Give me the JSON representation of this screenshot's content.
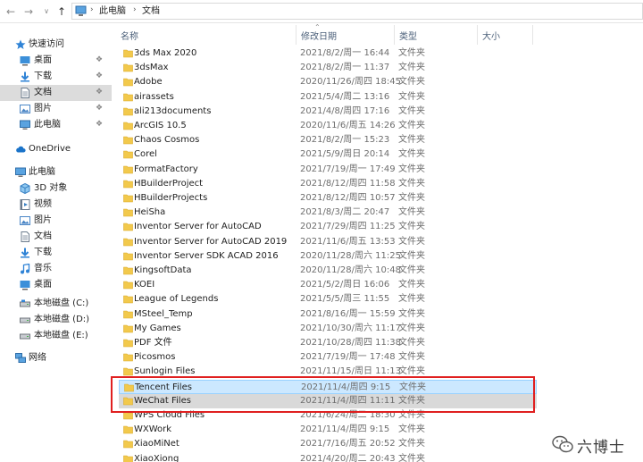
{
  "nav": {
    "back_icon": "arrow-left-icon",
    "forward_icon": "arrow-right-icon",
    "recent_icon": "chevron-down-icon",
    "up_icon": "arrow-up-icon"
  },
  "breadcrumb": [
    "此电脑",
    "文档"
  ],
  "columns": {
    "name": "名称",
    "date": "修改日期",
    "type": "类型",
    "size": "大小"
  },
  "sidebar": {
    "quick_access": "快速访问",
    "quick_items": [
      {
        "label": "桌面",
        "icon": "desktop-icon",
        "pinned": true
      },
      {
        "label": "下载",
        "icon": "download-icon",
        "pinned": true
      },
      {
        "label": "文档",
        "icon": "document-icon",
        "pinned": true,
        "selected": true
      },
      {
        "label": "图片",
        "icon": "picture-icon",
        "pinned": true
      },
      {
        "label": "此电脑",
        "icon": "computer-icon",
        "pinned": true
      }
    ],
    "onedrive": "OneDrive",
    "this_pc": "此电脑",
    "pc_items": [
      {
        "label": "3D 对象",
        "icon": "3d-objects-icon"
      },
      {
        "label": "视频",
        "icon": "video-icon"
      },
      {
        "label": "图片",
        "icon": "picture-icon"
      },
      {
        "label": "文档",
        "icon": "document-icon"
      },
      {
        "label": "下载",
        "icon": "download-icon"
      },
      {
        "label": "音乐",
        "icon": "music-icon"
      },
      {
        "label": "桌面",
        "icon": "desktop-icon"
      },
      {
        "label": "本地磁盘 (C:)",
        "icon": "drive-icon"
      },
      {
        "label": "本地磁盘 (D:)",
        "icon": "drive-icon"
      },
      {
        "label": "本地磁盘 (E:)",
        "icon": "drive-icon"
      }
    ],
    "network": "网络"
  },
  "files": [
    {
      "name": "3ds Max 2020",
      "date": "2021/8/2/周一 16:44",
      "type": "文件夹"
    },
    {
      "name": "3dsMax",
      "date": "2021/8/2/周一 11:37",
      "type": "文件夹"
    },
    {
      "name": "Adobe",
      "date": "2020/11/26/周四 18:45",
      "type": "文件夹"
    },
    {
      "name": "airassets",
      "date": "2021/5/4/周二 13:16",
      "type": "文件夹"
    },
    {
      "name": "ali213documents",
      "date": "2021/4/8/周四 17:16",
      "type": "文件夹"
    },
    {
      "name": "ArcGIS 10.5",
      "date": "2020/11/6/周五 14:26",
      "type": "文件夹"
    },
    {
      "name": "Chaos Cosmos",
      "date": "2021/8/2/周一 15:23",
      "type": "文件夹"
    },
    {
      "name": "Corel",
      "date": "2021/5/9/周日 20:14",
      "type": "文件夹"
    },
    {
      "name": "FormatFactory",
      "date": "2021/7/19/周一 17:49",
      "type": "文件夹"
    },
    {
      "name": "HBuilderProject",
      "date": "2021/8/12/周四 11:58",
      "type": "文件夹"
    },
    {
      "name": "HBuilderProjects",
      "date": "2021/8/12/周四 10:57",
      "type": "文件夹"
    },
    {
      "name": "HeiSha",
      "date": "2021/8/3/周二 20:47",
      "type": "文件夹"
    },
    {
      "name": "Inventor Server for AutoCAD",
      "date": "2021/7/29/周四 11:25",
      "type": "文件夹"
    },
    {
      "name": "Inventor Server for AutoCAD 2019",
      "date": "2021/11/6/周五 13:53",
      "type": "文件夹"
    },
    {
      "name": "Inventor Server SDK ACAD 2016",
      "date": "2020/11/28/周六 11:25",
      "type": "文件夹"
    },
    {
      "name": "KingsoftData",
      "date": "2020/11/28/周六 10:48",
      "type": "文件夹"
    },
    {
      "name": "KOEI",
      "date": "2021/5/2/周日 16:06",
      "type": "文件夹"
    },
    {
      "name": "League of Legends",
      "date": "2021/5/5/周三 11:55",
      "type": "文件夹"
    },
    {
      "name": "MSteel_Temp",
      "date": "2021/8/16/周一 15:59",
      "type": "文件夹"
    },
    {
      "name": "My Games",
      "date": "2021/10/30/周六 11:17",
      "type": "文件夹"
    },
    {
      "name": "PDF 文件",
      "date": "2021/10/28/周四 11:38",
      "type": "文件夹"
    },
    {
      "name": "Picosmos",
      "date": "2021/7/19/周一 17:48",
      "type": "文件夹"
    },
    {
      "name": "Sunlogin Files",
      "date": "2021/11/15/周日 11:13",
      "type": "文件夹"
    },
    {
      "name": "Tencent Files",
      "date": "2021/11/4/周四 9:15",
      "type": "文件夹",
      "state": "selected"
    },
    {
      "name": "WeChat Files",
      "date": "2021/11/4/周四 11:11",
      "type": "文件夹",
      "state": "hover"
    },
    {
      "name": "WPS Cloud Files",
      "date": "2021/6/24/周二 18:30",
      "type": "文件夹"
    },
    {
      "name": "WXWork",
      "date": "2021/11/4/周四 9:15",
      "type": "文件夹"
    },
    {
      "name": "XiaoMiNet",
      "date": "2021/7/16/周五 20:52",
      "type": "文件夹"
    },
    {
      "name": "XiaoXiong",
      "date": "2021/4/20/周二 20:43",
      "type": "文件夹"
    }
  ],
  "watermark": {
    "text": "六博士",
    "icon": "wechat-icon"
  },
  "colors": {
    "selected_bg": "#cce8ff",
    "hover_bg": "#d9d9d9",
    "annotation": "#e02020",
    "folder": "#f2c94c"
  }
}
